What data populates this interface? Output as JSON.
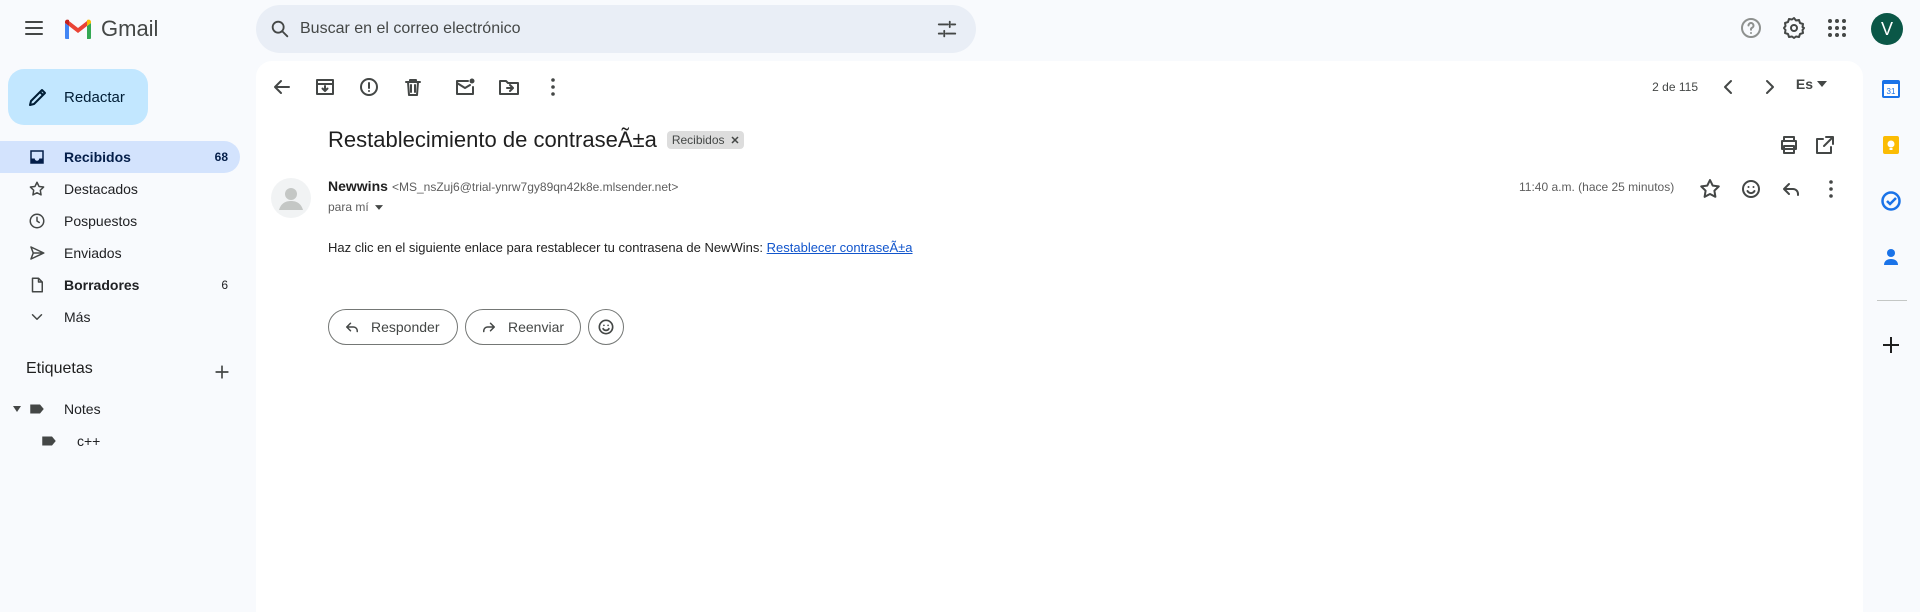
{
  "app": {
    "name": "Gmail"
  },
  "search": {
    "placeholder": "Buscar en el correo electrónico"
  },
  "user": {
    "initial": "V",
    "avatar_color": "#0b5747"
  },
  "sidebar": {
    "compose_label": "Redactar",
    "items": [
      {
        "label": "Recibidos",
        "count": "68",
        "icon": "inbox-icon"
      },
      {
        "label": "Destacados",
        "count": "",
        "icon": "star-icon"
      },
      {
        "label": "Pospuestos",
        "count": "",
        "icon": "clock-icon"
      },
      {
        "label": "Enviados",
        "count": "",
        "icon": "send-icon"
      },
      {
        "label": "Borradores",
        "count": "6",
        "icon": "draft-icon"
      },
      {
        "label": "Más",
        "count": "",
        "icon": "chevron-down-icon"
      }
    ],
    "labels_title": "Etiquetas",
    "labels": [
      {
        "name": "Notes"
      },
      {
        "name": "c++"
      }
    ]
  },
  "toolbar": {
    "pager": "2 de 115",
    "language": "Es"
  },
  "email": {
    "subject": "Restablecimiento de contraseÃ±a",
    "label_chip": "Recibidos",
    "sender_name": "Newwins",
    "sender_email": "<MS_nsZuj6@trial-ynrw7gy89qn42k8e.mlsender.net>",
    "to": "para mí",
    "time": "11:40 a.m. (hace 25 minutos)",
    "body_text": "Haz clic en el siguiente enlace para restablecer tu contrasena de NewWins: ",
    "body_link": "Restablecer contraseÃ±a"
  },
  "actions": {
    "reply": "Responder",
    "forward": "Reenviar"
  },
  "colors": {
    "accent": "#0b57d0",
    "compose_bg": "#c2e7ff",
    "active_nav": "#d3e3fd",
    "link": "#1155cc"
  }
}
